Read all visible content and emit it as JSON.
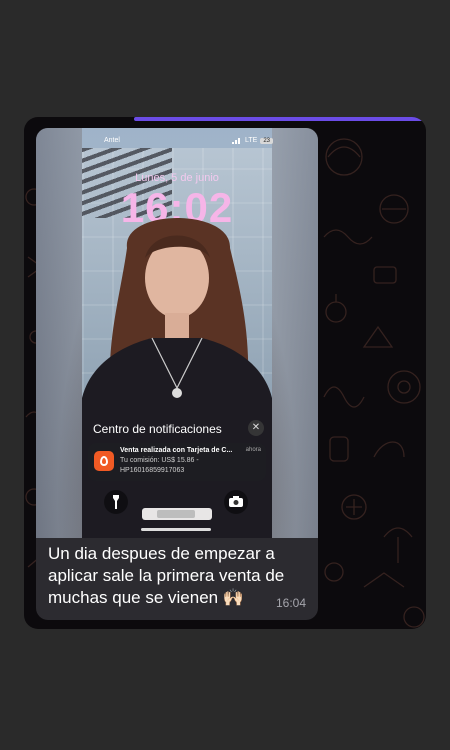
{
  "colors": {
    "page_bg": "#2a2a2a",
    "chat_bg": "#0c0a0d",
    "accent": "#6b4ce6",
    "bubble_bg": "#2c2b30",
    "lock_date": "#f2c9ee",
    "lock_time": "#f6b5e8",
    "app_icon": "#f15a24"
  },
  "media": {
    "status": {
      "carrier": "Antel",
      "network": "LTE",
      "battery": "23"
    },
    "lock_date": "Lunes, 5 de junio",
    "lock_time": "16:02",
    "notification_center": "Centro de notificaciones",
    "notification": {
      "app_icon": "hotmart-flame-icon",
      "line1": "Venta realizada con Tarjeta de C...",
      "line2": "Tu comisión: US$ 15.86 -",
      "line3": "HP16016859917063",
      "time": "ahora"
    }
  },
  "caption": {
    "text": "Un dia despues de empezar a aplicar sale la primera venta  de muchas que se vienen 🙌🏻",
    "time": "16:04"
  }
}
